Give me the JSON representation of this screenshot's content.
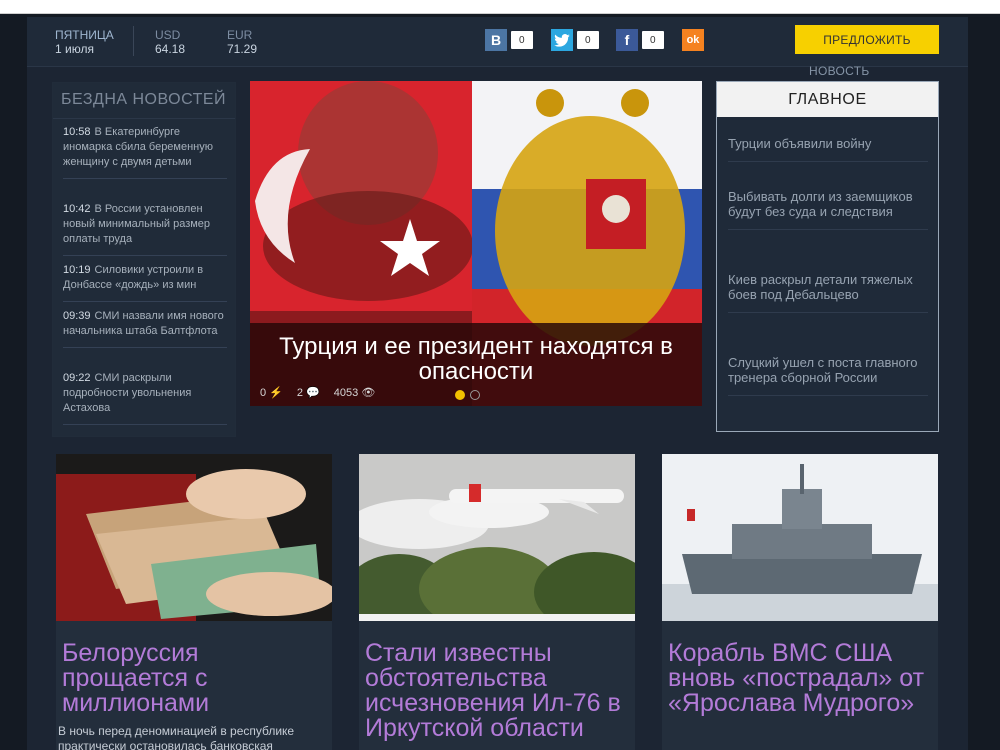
{
  "header": {
    "day": "ПЯТНИЦА",
    "date": "1 июля",
    "currencies": [
      {
        "code": "USD",
        "value": "64.18"
      },
      {
        "code": "EUR",
        "value": "71.29"
      }
    ],
    "social": [
      {
        "icon": "vk-icon",
        "glyph": "В",
        "count": "0",
        "color": "#4c75a3"
      },
      {
        "icon": "twitter-icon",
        "glyph": "🐦",
        "count": "0",
        "color": "#2ca7e0"
      },
      {
        "icon": "facebook-icon",
        "glyph": "f",
        "count": "0",
        "color": "#3b5998"
      },
      {
        "icon": "odnoklassniki-icon",
        "glyph": "ok",
        "color": "#f58220"
      }
    ],
    "suggest_label": "ПРЕДЛОЖИТЬ",
    "suggest_sub": "НОВОСТЬ"
  },
  "sidebar": {
    "title": "БЕЗДНА НОВОСТЕЙ",
    "items": [
      {
        "time": "10:58",
        "text": "В Екатеринбурге иномарка сбила беременную женщину с двумя детьми"
      },
      {
        "time": "10:42",
        "text": "В России установлен новый минимальный размер оплаты труда"
      },
      {
        "time": "10:19",
        "text": "Силовики устроили в Донбассе «дождь» из мин"
      },
      {
        "time": "09:39",
        "text": "СМИ назвали имя нового начальника штаба Балтфлота"
      },
      {
        "time": "09:22",
        "text": "СМИ раскрыли подробности увольнения Астахова"
      }
    ]
  },
  "hero": {
    "title": "Турция и ее президент находятся в опасности",
    "stats": {
      "shares": "0",
      "comments": "2",
      "views": "4053"
    }
  },
  "main_news": {
    "title": "ГЛАВНОЕ",
    "items": [
      "Турции объявили войну",
      "Выбивать долги из заемщиков будут без суда и следствия",
      "Киев раскрыл детали тяжелых боев под Дебальцево",
      "Слуцкий ушел с поста главного тренера сборной России"
    ]
  },
  "cards": [
    {
      "title": "Белоруссия прощается с миллионами",
      "text": "В ночь перед деноминацией в республике практически остановилась банковская"
    },
    {
      "title": "Стали известны обстоятельства исчезновения Ил-76 в Иркутской области",
      "text": ""
    },
    {
      "title": "Корабль ВМС США вновь «пострадал» от «Ярослава Мудрого»",
      "text": ""
    }
  ],
  "colors": {
    "accent": "#f7d000",
    "card_title": "#b37bd8",
    "background": "#1c2533"
  }
}
